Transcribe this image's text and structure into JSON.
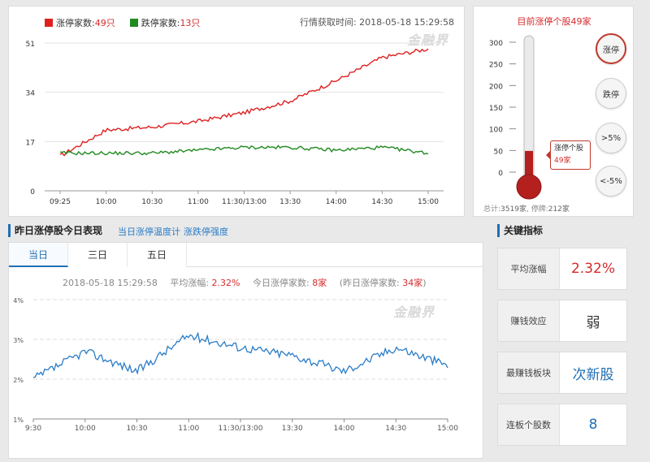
{
  "top_chart": {
    "legend": {
      "up_label": "涨停家数:",
      "up_value": "49只",
      "down_label": "跌停家数:",
      "down_value": "13只",
      "up_color": "#e02020",
      "down_color": "#1f8a1f"
    },
    "fetch_time": "行情获取时间: 2018-05-18 15:29:58",
    "watermark": "金融界",
    "y_ticks": [
      "51",
      "34",
      "17",
      "0"
    ],
    "x_ticks": [
      "09:25",
      "10:00",
      "10:30",
      "11:00",
      "11:30/13:00",
      "13:30",
      "14:00",
      "14:30",
      "15:00"
    ]
  },
  "thermometer": {
    "title": "目前涨停个股49家",
    "scale": [
      "300",
      "250",
      "200",
      "150",
      "100",
      "50",
      "0"
    ],
    "level_value": 49,
    "scale_max": 300,
    "tip_line1": "涨停个股",
    "tip_value": "49家",
    "buttons": [
      {
        "label": "涨停",
        "active": true
      },
      {
        "label": "跌停",
        "active": false
      },
      {
        "label": ">5%",
        "active": false
      },
      {
        "label": "<-5%",
        "active": false
      }
    ],
    "footer_total_label": "总计:",
    "footer_total_value": "3519家",
    "footer_halt_label": "停牌:",
    "footer_halt_value": "212家"
  },
  "section": {
    "title": "昨日涨停股今日表现",
    "links": [
      "当日涨停温度计",
      "涨跌停强度"
    ]
  },
  "bottom_chart": {
    "tabs": [
      {
        "label": "当日",
        "active": true
      },
      {
        "label": "三日",
        "active": false
      },
      {
        "label": "五日",
        "active": false
      }
    ],
    "stat_time": "2018-05-18 15:29:58",
    "avg_label": "平均涨幅:",
    "avg_value": "2.32%",
    "up_count_label": "今日涨停家数:",
    "up_count_value": "8家",
    "yest_label_pre": "(昨日涨停家数:",
    "yest_value": "34家",
    "yest_label_post": ")",
    "watermark": "金融界",
    "y_ticks": [
      "4%",
      "3%",
      "2%",
      "1%"
    ],
    "x_ticks": [
      "9:30",
      "10:00",
      "10:30",
      "11:00",
      "11:30/13:00",
      "13:30",
      "14:00",
      "14:30",
      "15:00"
    ]
  },
  "key_indicators": {
    "title": "关键指标",
    "cards": [
      {
        "label": "平均涨幅",
        "value": "2.32%",
        "style": "red"
      },
      {
        "label": "赚钱效应",
        "value": "弱",
        "style": "dark"
      },
      {
        "label": "最赚钱板块",
        "value": "次新股",
        "style": "blue"
      },
      {
        "label": "连板个股数",
        "value": "8",
        "style": "blue"
      }
    ]
  },
  "chart_data": [
    {
      "type": "line",
      "x": [
        "09:25",
        "10:00",
        "10:30",
        "11:00",
        "11:30/13:00",
        "13:30",
        "14:00",
        "14:30",
        "15:00"
      ],
      "ylim": [
        0,
        51
      ],
      "series": [
        {
          "name": "涨停家数",
          "color": "#e02020",
          "values": [
            12,
            21,
            22,
            24,
            27,
            31,
            38,
            46,
            49
          ]
        },
        {
          "name": "跌停家数",
          "color": "#1f8a1f",
          "values": [
            13,
            13,
            13,
            14,
            15,
            15,
            14,
            15,
            13
          ]
        }
      ]
    },
    {
      "type": "line",
      "x": [
        "9:30",
        "10:00",
        "10:30",
        "11:00",
        "11:30/13:00",
        "13:30",
        "14:00",
        "14:30",
        "15:00"
      ],
      "ylim": [
        1,
        4
      ],
      "series": [
        {
          "values": [
            2.0,
            2.7,
            2.2,
            3.1,
            2.8,
            2.6,
            2.2,
            2.8,
            2.35
          ]
        }
      ]
    }
  ]
}
